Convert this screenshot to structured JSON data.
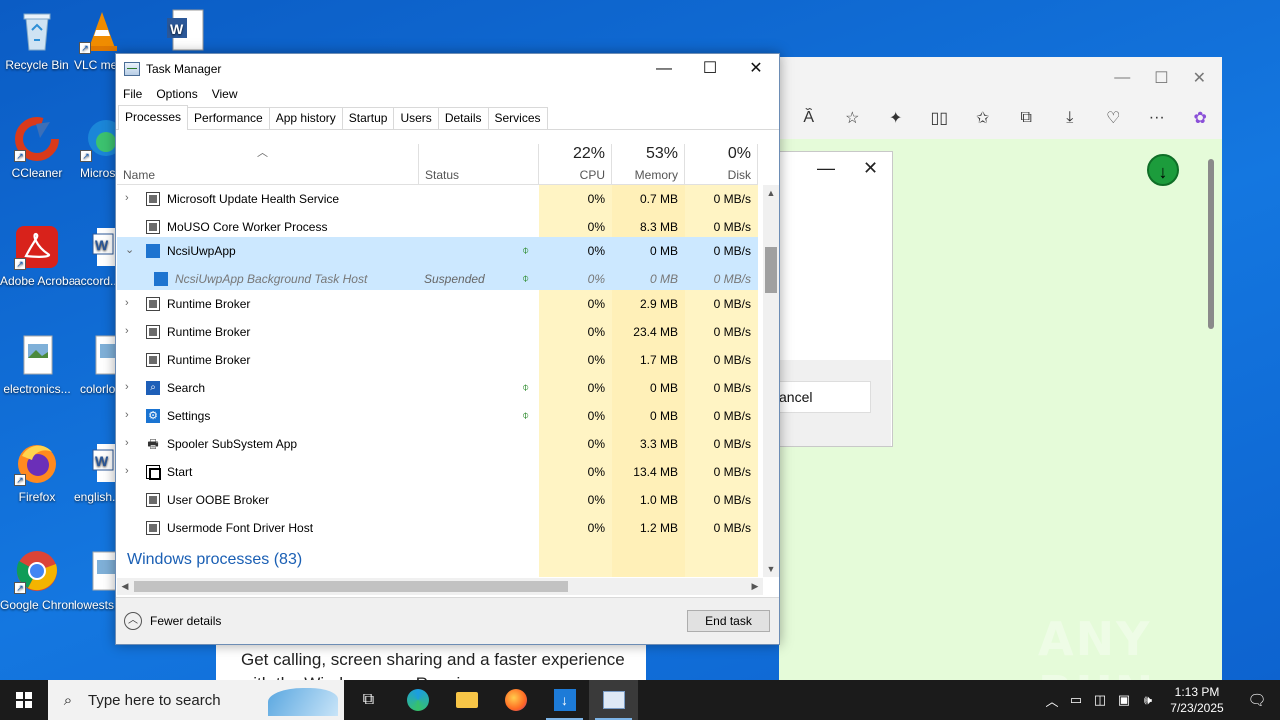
{
  "desktop": {
    "icons": [
      {
        "name": "recycle-bin",
        "label": "Recycle Bin"
      },
      {
        "name": "vlc",
        "label": "VLC media player"
      },
      {
        "name": "word-doc-top",
        "label": ""
      },
      {
        "name": "ccleaner",
        "label": "CCleaner"
      },
      {
        "name": "edge",
        "label": "Microsoft Edge"
      },
      {
        "name": "adobe-acrobat",
        "label": "Adobe Acrobat"
      },
      {
        "name": "accord-doc",
        "label": "accord..."
      },
      {
        "name": "electronics-img",
        "label": "electronics..."
      },
      {
        "name": "colorlo-img",
        "label": "colorlo..."
      },
      {
        "name": "firefox",
        "label": "Firefox"
      },
      {
        "name": "english-doc",
        "label": "english..."
      },
      {
        "name": "google-chrome",
        "label": "Google Chrome"
      },
      {
        "name": "lowests-img",
        "label": "lowests..."
      }
    ]
  },
  "edge_window": {
    "dialog_cancel": "ancel",
    "page_text": "Get calling, screen sharing and a faster experience with the Windows app. Requires"
  },
  "task_manager": {
    "title": "Task Manager",
    "menu": [
      "File",
      "Options",
      "View"
    ],
    "tabs": [
      "Processes",
      "Performance",
      "App history",
      "Startup",
      "Users",
      "Details",
      "Services"
    ],
    "active_tab": "Processes",
    "columns": {
      "name": "Name",
      "status": "Status",
      "cpu": {
        "label": "CPU",
        "pct": "22%"
      },
      "memory": {
        "label": "Memory",
        "pct": "53%"
      },
      "disk": {
        "label": "Disk",
        "pct": "0%"
      }
    },
    "rows": [
      {
        "name": "Microsoft Update Health Service",
        "expand": ">",
        "icon": "window",
        "status": "",
        "leaf": false,
        "cpu": "0%",
        "mem": "0.7 MB",
        "disk": "0 MB/s"
      },
      {
        "name": "MoUSO Core Worker Process",
        "expand": "",
        "icon": "window",
        "status": "",
        "leaf": false,
        "cpu": "0%",
        "mem": "8.3 MB",
        "disk": "0 MB/s"
      },
      {
        "name": "NcsiUwpApp",
        "expand": "v",
        "icon": "blue",
        "status": "",
        "leaf": true,
        "cpu": "0%",
        "mem": "0 MB",
        "disk": "0 MB/s"
      },
      {
        "name": "NcsiUwpApp Background Task Host",
        "expand": "",
        "icon": "blue",
        "status": "Suspended",
        "leaf": true,
        "cpu": "0%",
        "mem": "0 MB",
        "disk": "0 MB/s"
      },
      {
        "name": "Runtime Broker",
        "expand": ">",
        "icon": "window",
        "status": "",
        "leaf": false,
        "cpu": "0%",
        "mem": "2.9 MB",
        "disk": "0 MB/s"
      },
      {
        "name": "Runtime Broker",
        "expand": ">",
        "icon": "window",
        "status": "",
        "leaf": false,
        "cpu": "0%",
        "mem": "23.4 MB",
        "disk": "0 MB/s"
      },
      {
        "name": "Runtime Broker",
        "expand": "",
        "icon": "window",
        "status": "",
        "leaf": false,
        "cpu": "0%",
        "mem": "1.7 MB",
        "disk": "0 MB/s"
      },
      {
        "name": "Search",
        "expand": ">",
        "icon": "search",
        "status": "",
        "leaf": true,
        "cpu": "0%",
        "mem": "0 MB",
        "disk": "0 MB/s"
      },
      {
        "name": "Settings",
        "expand": ">",
        "icon": "gear",
        "status": "",
        "leaf": true,
        "cpu": "0%",
        "mem": "0 MB",
        "disk": "0 MB/s"
      },
      {
        "name": "Spooler SubSystem App",
        "expand": ">",
        "icon": "printer",
        "status": "",
        "leaf": false,
        "cpu": "0%",
        "mem": "3.3 MB",
        "disk": "0 MB/s"
      },
      {
        "name": "Start",
        "expand": ">",
        "icon": "start",
        "status": "",
        "leaf": false,
        "cpu": "0%",
        "mem": "13.4 MB",
        "disk": "0 MB/s"
      },
      {
        "name": "User OOBE Broker",
        "expand": "",
        "icon": "window",
        "status": "",
        "leaf": false,
        "cpu": "0%",
        "mem": "1.0 MB",
        "disk": "0 MB/s"
      },
      {
        "name": "Usermode Font Driver Host",
        "expand": "",
        "icon": "window",
        "status": "",
        "leaf": false,
        "cpu": "0%",
        "mem": "1.2 MB",
        "disk": "0 MB/s"
      }
    ],
    "section_label": "Windows processes (83)",
    "fewer_details": "Fewer details",
    "end_task": "End task",
    "colors": {
      "cpu_col": "#fff4c4",
      "mem_col": "#fff0b8",
      "selected": "#cce8ff"
    }
  },
  "watermark": "ANY RUN",
  "taskbar": {
    "search_placeholder": "Type here to search",
    "time": "1:13 PM",
    "date": "7/23/2025"
  }
}
